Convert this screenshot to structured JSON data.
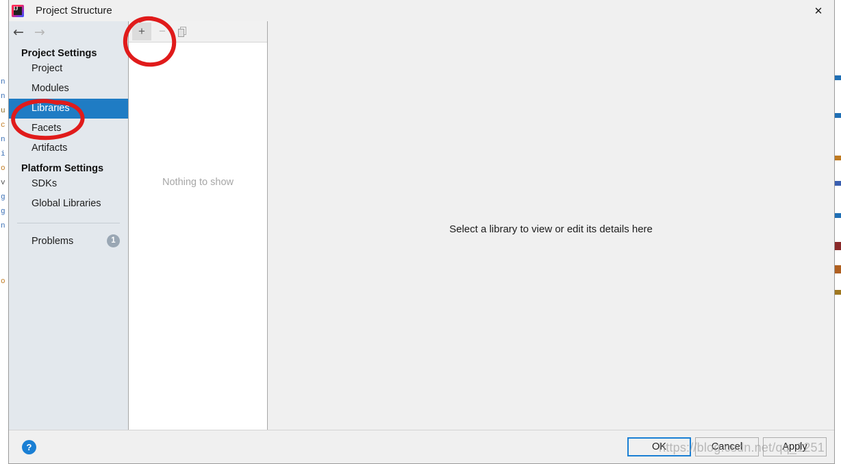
{
  "window": {
    "title": "Project Structure",
    "app_icon": "intellij-idea-icon",
    "app_icon_letters": "IJ",
    "close_icon": "✕"
  },
  "navigation": {
    "back_icon": "←",
    "forward_icon": "→"
  },
  "sidebar": {
    "groups": [
      {
        "label": "Project Settings",
        "items": [
          {
            "label": "Project",
            "selected": false
          },
          {
            "label": "Modules",
            "selected": false
          },
          {
            "label": "Libraries",
            "selected": true
          },
          {
            "label": "Facets",
            "selected": false
          },
          {
            "label": "Artifacts",
            "selected": false
          }
        ]
      },
      {
        "label": "Platform Settings",
        "items": [
          {
            "label": "SDKs",
            "selected": false
          },
          {
            "label": "Global Libraries",
            "selected": false
          }
        ]
      }
    ],
    "problems": {
      "label": "Problems",
      "count": "1"
    }
  },
  "middle_panel": {
    "toolbar": {
      "add_icon": "+",
      "remove_icon": "−",
      "copy_icon": "copy-icon"
    },
    "empty_text": "Nothing to show"
  },
  "right_panel": {
    "hint": "Select a library to view or edit its details here"
  },
  "footer": {
    "help_icon": "?",
    "buttons": [
      {
        "label": "OK",
        "default": true
      },
      {
        "label": "Cancel",
        "default": false
      },
      {
        "label": "Apply",
        "default": false
      }
    ]
  },
  "annotations": {
    "circle_color": "#e01b1b",
    "circle_plus_target": "add-library-button",
    "circle_libraries_target": "sidebar-item-libraries"
  },
  "watermark": {
    "text": "https://blog.csdn.net/qq_1251"
  },
  "colors": {
    "selection_blue": "#1f7cc4",
    "accent_blue": "#1a7fd4",
    "sidebar_bg": "#e3e8ed",
    "dialog_bg": "#f0f0f0",
    "panel_bg": "#ffffff",
    "annotation_red": "#e01b1b",
    "badge_gray": "#9aa7b4"
  },
  "background_strip": {
    "left_fragments": [
      "n",
      "n",
      "u",
      "c",
      "n",
      "i",
      "o",
      "v",
      "g",
      "g",
      "n",
      "o"
    ],
    "right_marks": [
      "#1f6fb5",
      "#1f6fb5",
      "#c07a20",
      "#3a5fb0",
      "#1f6fb5",
      "#8a2a2a",
      "#b06020",
      "#a07820"
    ]
  }
}
